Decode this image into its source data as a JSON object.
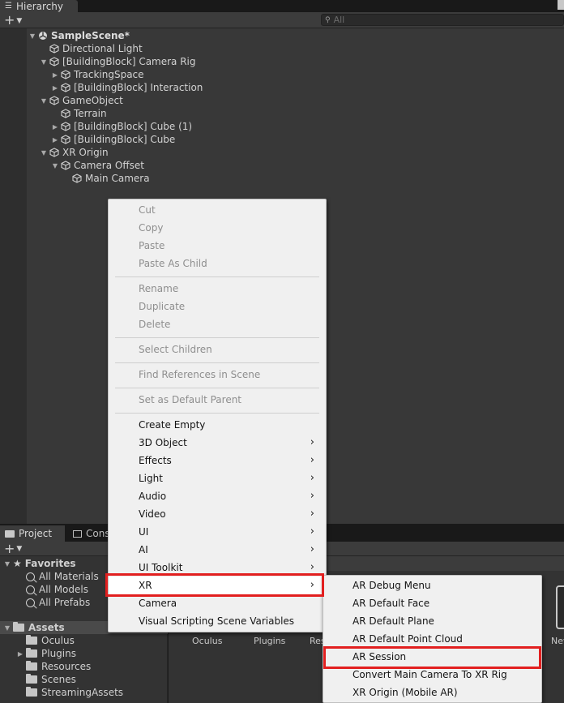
{
  "colors": {
    "highlight": "#e21f1f",
    "menu_bg": "#f0f0f0",
    "panel_bg": "#383838"
  },
  "hierarchy": {
    "tab_label": "Hierarchy",
    "add_label": "+",
    "search_placeholder": "All",
    "items": [
      {
        "label": "SampleScene*",
        "icon": "unity-scene-icon",
        "depth": 0,
        "fold": "expanded"
      },
      {
        "label": "Directional Light",
        "icon": "cube-icon",
        "depth": 1,
        "fold": "none"
      },
      {
        "label": "[BuildingBlock] Camera Rig",
        "icon": "cube-icon",
        "depth": 1,
        "fold": "expanded"
      },
      {
        "label": "TrackingSpace",
        "icon": "cube-icon",
        "depth": 2,
        "fold": "collapsed"
      },
      {
        "label": "[BuildingBlock] Interaction",
        "icon": "cube-icon",
        "depth": 2,
        "fold": "collapsed"
      },
      {
        "label": "GameObject",
        "icon": "cube-icon",
        "depth": 1,
        "fold": "expanded"
      },
      {
        "label": "Terrain",
        "icon": "cube-icon",
        "depth": 2,
        "fold": "none"
      },
      {
        "label": "[BuildingBlock] Cube (1)",
        "icon": "cube-icon",
        "depth": 2,
        "fold": "collapsed"
      },
      {
        "label": "[BuildingBlock] Cube",
        "icon": "cube-icon",
        "depth": 2,
        "fold": "collapsed"
      },
      {
        "label": "XR Origin",
        "icon": "cube-icon",
        "depth": 1,
        "fold": "expanded"
      },
      {
        "label": "Camera Offset",
        "icon": "cube-icon",
        "depth": 2,
        "fold": "expanded"
      },
      {
        "label": "Main Camera",
        "icon": "cube-icon",
        "depth": 3,
        "fold": "none"
      }
    ]
  },
  "context_menu": {
    "items": [
      {
        "label": "Cut",
        "enabled": false
      },
      {
        "label": "Copy",
        "enabled": false
      },
      {
        "label": "Paste",
        "enabled": false
      },
      {
        "label": "Paste As Child",
        "enabled": false
      },
      {
        "label": "Rename",
        "enabled": false
      },
      {
        "label": "Duplicate",
        "enabled": false
      },
      {
        "label": "Delete",
        "enabled": false
      },
      {
        "label": "Select Children",
        "enabled": false
      },
      {
        "label": "Find References in Scene",
        "enabled": false
      },
      {
        "label": "Set as Default Parent",
        "enabled": false
      },
      {
        "label": "Create Empty",
        "enabled": true,
        "submenu": false
      },
      {
        "label": "3D Object",
        "enabled": true,
        "submenu": true
      },
      {
        "label": "Effects",
        "enabled": true,
        "submenu": true
      },
      {
        "label": "Light",
        "enabled": true,
        "submenu": true
      },
      {
        "label": "Audio",
        "enabled": true,
        "submenu": true
      },
      {
        "label": "Video",
        "enabled": true,
        "submenu": true
      },
      {
        "label": "UI",
        "enabled": true,
        "submenu": true
      },
      {
        "label": "AI",
        "enabled": true,
        "submenu": true
      },
      {
        "label": "UI Toolkit",
        "enabled": true,
        "submenu": true
      },
      {
        "label": "XR",
        "enabled": true,
        "submenu": true,
        "highlighted": true
      },
      {
        "label": "Camera",
        "enabled": true,
        "submenu": false
      },
      {
        "label": "Visual Scripting Scene Variables",
        "enabled": true,
        "submenu": false
      }
    ],
    "submenu_arrow": "›"
  },
  "xr_submenu": {
    "items": [
      {
        "label": "AR Debug Menu"
      },
      {
        "label": "AR Default Face"
      },
      {
        "label": "AR Default Plane"
      },
      {
        "label": "AR Default Point Cloud"
      },
      {
        "label": "AR Session",
        "highlighted": true
      },
      {
        "label": "Convert Main Camera To XR Rig"
      },
      {
        "label": "XR Origin (Mobile AR)"
      }
    ]
  },
  "project": {
    "tab_project": "Project",
    "tab_console": "Cons",
    "add_label": "+",
    "favorites_label": "Favorites",
    "favorites": [
      "All Materials",
      "All Models",
      "All Prefabs"
    ],
    "assets_label": "Assets",
    "folders": [
      "Oculus",
      "Plugins",
      "Resources",
      "Scenes",
      "StreamingAssets"
    ],
    "grid_items": [
      "Oculus",
      "Plugins",
      "Res",
      "Nev"
    ]
  }
}
